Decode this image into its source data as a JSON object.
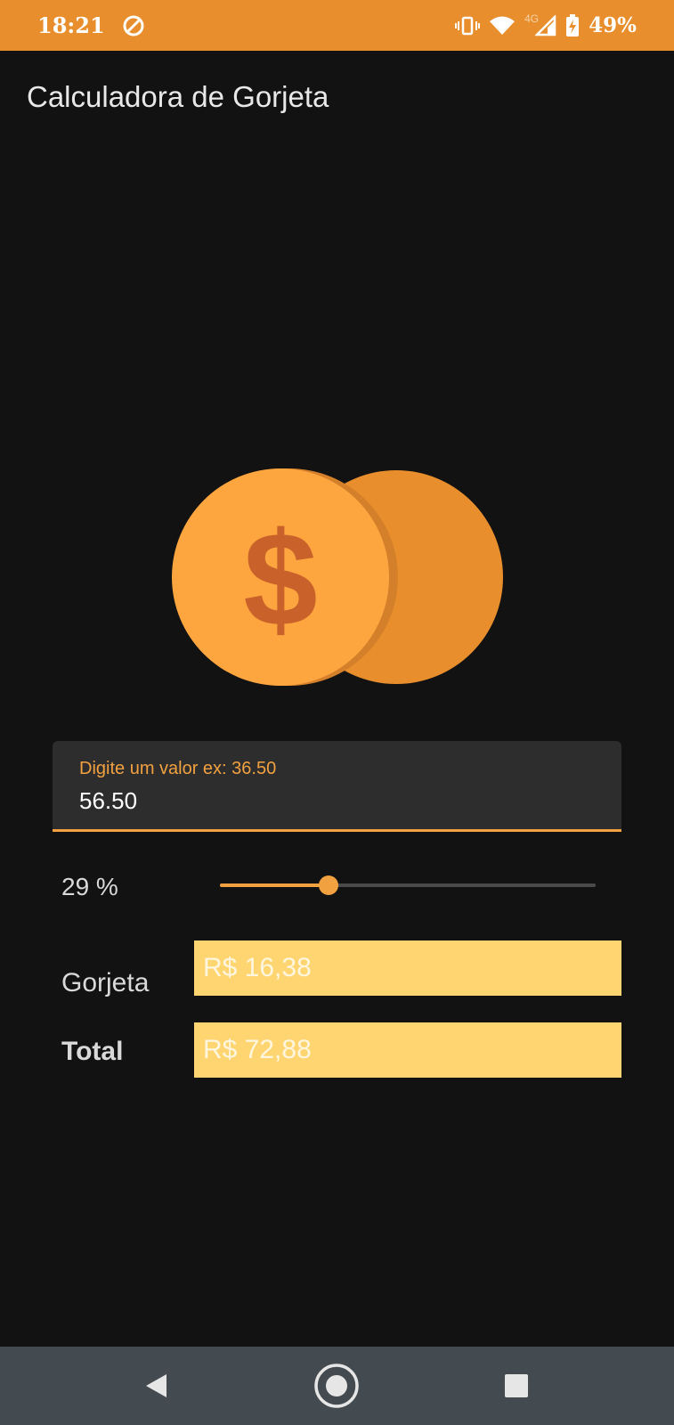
{
  "status_bar": {
    "time": "18:21",
    "network_label": "4G",
    "battery_percent": "49%",
    "icons": [
      "sync-icon",
      "vibrate-icon",
      "wifi-icon",
      "signal-icon",
      "battery-charging-icon"
    ]
  },
  "app": {
    "title": "Calculadora de Gorjeta"
  },
  "input": {
    "label": "Digite um valor ex: 36.50",
    "value": "56.50"
  },
  "tip_slider": {
    "label": "29 %",
    "value_percent": 29,
    "fill_fraction": 0.29
  },
  "results": {
    "tip_label": "Gorjeta",
    "tip_value": "R$ 16,38",
    "total_label": "Total",
    "total_value": "R$ 72,88"
  },
  "colors": {
    "status_bar": "#e88e2c",
    "accent": "#f2a140",
    "background": "#121212",
    "result_box": "#ffd571",
    "coin_front": "#fda53f",
    "coin_back": "#e88e2c",
    "dollar_sign": "#c9612a",
    "nav_bar": "#434a50"
  },
  "nav_bar": {
    "icons": [
      "back-icon",
      "home-icon",
      "recents-icon"
    ]
  }
}
